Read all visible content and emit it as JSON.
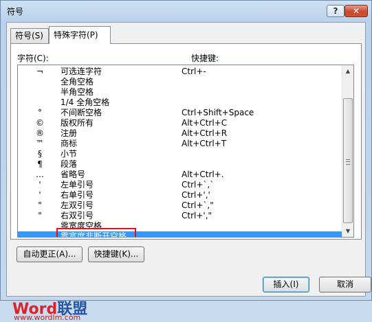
{
  "window": {
    "title": "符号",
    "help_label": "?",
    "close_label": "✕"
  },
  "tabs": [
    {
      "label": "符号(S)"
    },
    {
      "label": "特殊字符(P)",
      "active": true
    }
  ],
  "columns": {
    "char": "字符(C):",
    "shortcut": "快捷键:"
  },
  "rows": [
    {
      "sym": "¬",
      "name": "可选连字符",
      "key": "Ctrl+-"
    },
    {
      "sym": "",
      "name": "全角空格",
      "key": ""
    },
    {
      "sym": "",
      "name": "半角空格",
      "key": ""
    },
    {
      "sym": "",
      "name": "1/4 全角空格",
      "key": ""
    },
    {
      "sym": "°",
      "name": "不间断空格",
      "key": "Ctrl+Shift+Space"
    },
    {
      "sym": "©",
      "name": "版权所有",
      "key": "Alt+Ctrl+C"
    },
    {
      "sym": "®",
      "name": "注册",
      "key": "Alt+Ctrl+R"
    },
    {
      "sym": "™",
      "name": "商标",
      "key": "Alt+Ctrl+T"
    },
    {
      "sym": "§",
      "name": "小节",
      "key": ""
    },
    {
      "sym": "¶",
      "name": "段落",
      "key": ""
    },
    {
      "sym": "…",
      "name": "省略号",
      "key": "Alt+Ctrl+."
    },
    {
      "sym": "'",
      "name": "左单引号",
      "key": "Ctrl+`,`"
    },
    {
      "sym": "'",
      "name": "右单引号",
      "key": "Ctrl+','"
    },
    {
      "sym": "\"",
      "name": "左双引号",
      "key": "Ctrl+`,\""
    },
    {
      "sym": "\"",
      "name": "右双引号",
      "key": "Ctrl+',\""
    },
    {
      "sym": "",
      "name": "零宽度空格",
      "key": ""
    },
    {
      "sym": "",
      "name": "零宽度非断开空格",
      "key": "",
      "selected": true
    }
  ],
  "buttons": {
    "autocorrect": "自动更正(A)...",
    "shortcut": "快捷键(K)...",
    "insert": "插入(I)",
    "cancel": "取消"
  },
  "scrollbar": {
    "up": "▲",
    "down": "▼"
  },
  "watermark": {
    "logo_a": "Word",
    "logo_b": "联盟",
    "url": "www.wordlm.com"
  }
}
